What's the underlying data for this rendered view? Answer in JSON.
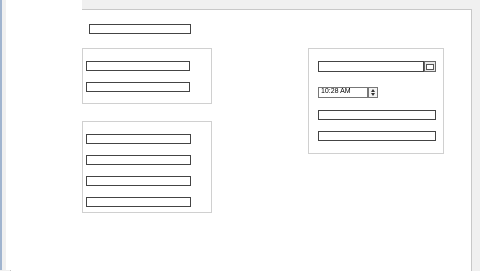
{
  "form": {
    "top_field_value": "",
    "group1": {
      "fields": [
        "",
        ""
      ]
    },
    "group2": {
      "fields": [
        "",
        "",
        "",
        ""
      ]
    },
    "group3": {
      "date_value": "",
      "time_value": "10:28 AM",
      "extra_fields": [
        "",
        ""
      ]
    }
  },
  "icons": {
    "calendar": "calendar-icon",
    "spin_up": "spin-up-arrow",
    "spin_down": "spin-down-arrow"
  },
  "colors": {
    "window_border": "#a0b4cf",
    "client_bg": "#ffffff",
    "frame_bg": "#f0f0f0"
  }
}
